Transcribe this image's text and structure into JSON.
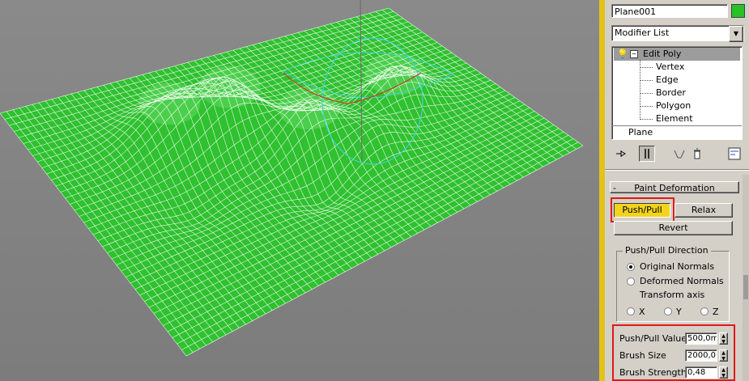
{
  "object": {
    "name": "Plane001",
    "color": "#27c227"
  },
  "modifier_list": {
    "label": "Modifier List"
  },
  "stack": {
    "modifier": "Edit Poly",
    "subobjects": [
      "Vertex",
      "Edge",
      "Border",
      "Polygon",
      "Element"
    ],
    "base": "Plane"
  },
  "toolbar": {
    "icons": [
      "pin-stack-icon",
      "show-end-result-icon",
      "make-unique-icon",
      "remove-modifier-icon",
      "configure-modifier-sets-icon"
    ]
  },
  "rollout": {
    "title": "Paint Deformation",
    "collapse_glyph": "-",
    "push_pull": "Push/Pull",
    "relax": "Relax",
    "revert": "Revert",
    "direction": {
      "title": "Push/Pull Direction",
      "original": "Original Normals",
      "deformed": "Deformed Normals",
      "transform": "Transform axis",
      "axes": [
        "X",
        "Y",
        "Z"
      ],
      "selected": "Original Normals"
    },
    "params": [
      {
        "label": "Push/Pull Value",
        "value": "500,0m"
      },
      {
        "label": "Brush Size",
        "value": "2000,0"
      },
      {
        "label": "Brush Strength",
        "value": "0,48"
      }
    ]
  },
  "colors": {
    "mesh": "#2fc12f",
    "wire": "#ffffff",
    "active_border": "#e3c31a",
    "highlight": "#e01818",
    "gizmo": "#3fd4d0"
  }
}
